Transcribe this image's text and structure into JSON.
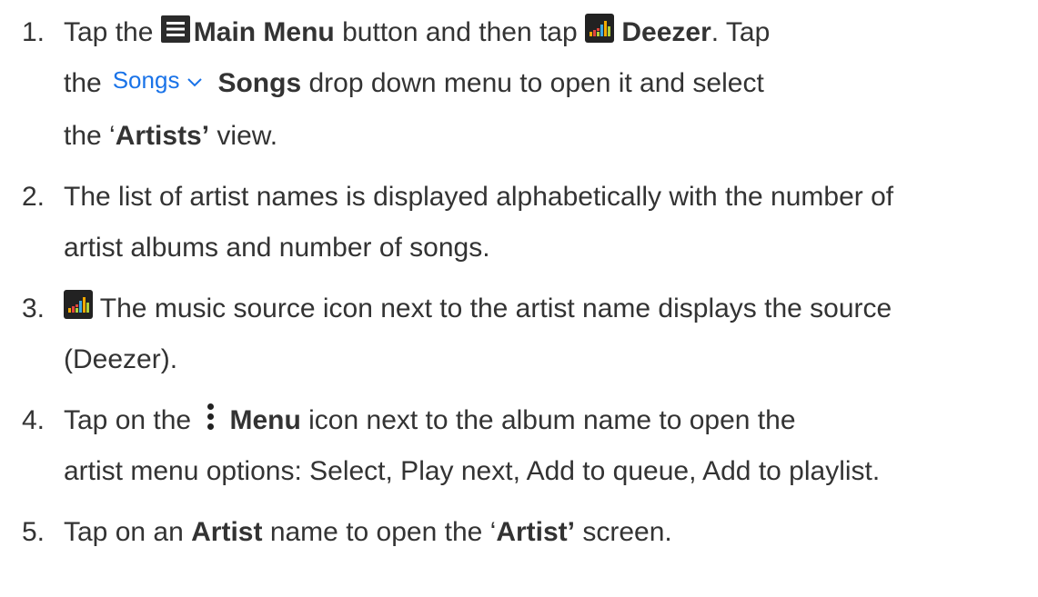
{
  "steps": [
    {
      "number": "1.",
      "line1_a": "Tap the",
      "main_menu": "Main Menu",
      "line1_b": "button and then tap",
      "deezer": "Deezer",
      "line1_c": ". Tap",
      "line2_a": "the",
      "songs_dropdown": "Songs",
      "songs_bold": "Songs",
      "line2_b": "drop down menu to open it and select",
      "line3_a": "the ‘",
      "artists": "Artists’",
      "line3_b": "view."
    },
    {
      "number": "2.",
      "line1": "The list of artist names is displayed alphabetically with the number of",
      "line2": "artist albums and number of songs."
    },
    {
      "number": "3.",
      "line1": "The music source icon next to the artist name displays the source",
      "line2": "(Deezer)."
    },
    {
      "number": "4.",
      "line1_a": "Tap on the",
      "menu": "Menu",
      "line1_b": "icon next to the album name to open the",
      "line2": "artist menu options: Select, Play next, Add to queue, Add to playlist."
    },
    {
      "number": "5.",
      "line1_a": "Tap on an",
      "artist": "Artist",
      "line1_b": "name to open the ‘",
      "artist_screen": "Artist’",
      "line1_c": "screen."
    }
  ],
  "icons": {
    "main_menu": "hamburger-menu-icon",
    "deezer": "deezer-equalizer-icon",
    "dropdown": "chevron-down-icon",
    "overflow": "vertical-ellipsis-icon"
  },
  "colors": {
    "text": "#333333",
    "link_blue": "#1a73e8",
    "icon_dark": "#222222"
  }
}
